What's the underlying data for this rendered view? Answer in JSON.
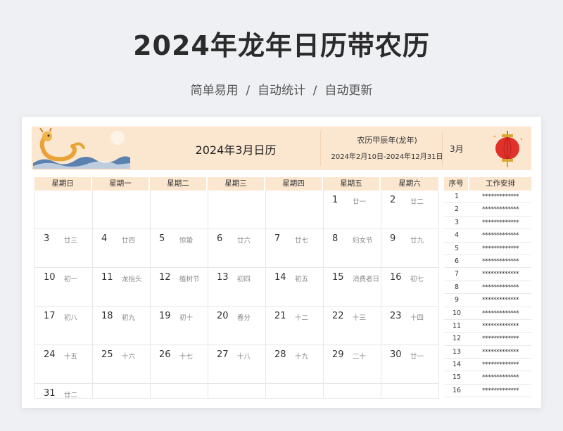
{
  "page": {
    "title": "2024年龙年日历带农历",
    "subtitle": "简单易用  /  自动统计  /  自动更新"
  },
  "banner": {
    "month_title": "2024年3月日历",
    "lunar_year": "农历甲辰年(龙年)",
    "lunar_range": "2024年2月10日-2024年12月31日",
    "month_short": "3月"
  },
  "weekdays": [
    "星期日",
    "星期一",
    "星期二",
    "星期三",
    "星期四",
    "星期五",
    "星期六"
  ],
  "calendar": {
    "first_weekday": 5,
    "days": [
      {
        "d": "1",
        "l": "廿一"
      },
      {
        "d": "2",
        "l": "廿二"
      },
      {
        "d": "3",
        "l": "廿三"
      },
      {
        "d": "4",
        "l": "廿四"
      },
      {
        "d": "5",
        "l": "惊蛰"
      },
      {
        "d": "6",
        "l": "廿六"
      },
      {
        "d": "7",
        "l": "廿七"
      },
      {
        "d": "8",
        "l": "妇女节"
      },
      {
        "d": "9",
        "l": "廿九"
      },
      {
        "d": "10",
        "l": "初一"
      },
      {
        "d": "11",
        "l": "龙抬头"
      },
      {
        "d": "12",
        "l": "植树节"
      },
      {
        "d": "13",
        "l": "初四"
      },
      {
        "d": "14",
        "l": "初五"
      },
      {
        "d": "15",
        "l": "消费者日"
      },
      {
        "d": "16",
        "l": "初七"
      },
      {
        "d": "17",
        "l": "初八"
      },
      {
        "d": "18",
        "l": "初九"
      },
      {
        "d": "19",
        "l": "初十"
      },
      {
        "d": "20",
        "l": "春分"
      },
      {
        "d": "21",
        "l": "十二"
      },
      {
        "d": "22",
        "l": "十三"
      },
      {
        "d": "23",
        "l": "十四"
      },
      {
        "d": "24",
        "l": "十五"
      },
      {
        "d": "25",
        "l": "十六"
      },
      {
        "d": "26",
        "l": "十七"
      },
      {
        "d": "27",
        "l": "十八"
      },
      {
        "d": "28",
        "l": "十九"
      },
      {
        "d": "29",
        "l": "二十"
      },
      {
        "d": "30",
        "l": "廿一"
      },
      {
        "d": "31",
        "l": "廿二"
      }
    ]
  },
  "tasks": {
    "header_no": "序号",
    "header_task": "工作安排",
    "rows": [
      {
        "no": "1",
        "task": "*************"
      },
      {
        "no": "2",
        "task": "*************"
      },
      {
        "no": "3",
        "task": "*************"
      },
      {
        "no": "4",
        "task": "*************"
      },
      {
        "no": "5",
        "task": "*************"
      },
      {
        "no": "6",
        "task": "*************"
      },
      {
        "no": "7",
        "task": "*************"
      },
      {
        "no": "8",
        "task": "*************"
      },
      {
        "no": "9",
        "task": "*************"
      },
      {
        "no": "10",
        "task": "*************"
      },
      {
        "no": "11",
        "task": "*************"
      },
      {
        "no": "12",
        "task": "*************"
      },
      {
        "no": "13",
        "task": "*************"
      },
      {
        "no": "14",
        "task": "*************"
      },
      {
        "no": "15",
        "task": "*************"
      },
      {
        "no": "16",
        "task": "*************"
      }
    ]
  },
  "icons": {
    "banner_left": "dragon-illustration",
    "banner_right": "red-lantern-icon"
  },
  "colors": {
    "banner": "#fbe6cf",
    "lantern": "#e0322b",
    "dragon": "#e9a236"
  }
}
